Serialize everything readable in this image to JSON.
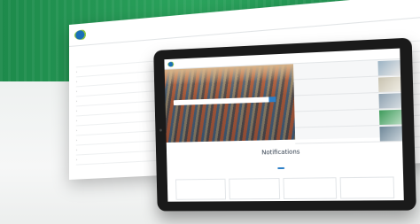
{
  "colors": {
    "brand_green": "#1f9150",
    "link_blue": "#2c7fc7",
    "tablet_frame": "#1a1a1a"
  },
  "back_page": {
    "logo_text": "",
    "nav": [
      "",
      "",
      "",
      "",
      "",
      "",
      "",
      ""
    ],
    "header_right": [
      "",
      ""
    ],
    "section_label": "",
    "breadcrumb": "",
    "table": {
      "headers": [
        "",
        ""
      ],
      "rows": [
        {
          "col1": "",
          "col2": ""
        },
        {
          "col1": "",
          "col2": ""
        },
        {
          "col1": "",
          "col2": ""
        },
        {
          "col1": "",
          "col2": ""
        },
        {
          "col1": "",
          "col2": ""
        },
        {
          "col1": "",
          "col2": ""
        },
        {
          "col1": "",
          "col2": ""
        },
        {
          "col1": "",
          "col2": ""
        },
        {
          "col1": "",
          "col2": ""
        },
        {
          "col1": "",
          "col2": ""
        }
      ]
    }
  },
  "tablet": {
    "header": {
      "logo_text": "",
      "nav": [
        "",
        "",
        "",
        "",
        ""
      ],
      "right": ""
    },
    "hero": {
      "search_placeholder": ""
    },
    "news": [
      {
        "text": ""
      },
      {
        "text": ""
      },
      {
        "text": ""
      },
      {
        "text": ""
      },
      {
        "text": ""
      }
    ],
    "section_title": "Notifications",
    "section_tab": "",
    "cards": [
      {
        "title": "",
        "sub": ""
      },
      {
        "title": "",
        "sub": ""
      },
      {
        "title": "",
        "sub": ""
      },
      {
        "title": "",
        "sub": ""
      }
    ]
  }
}
